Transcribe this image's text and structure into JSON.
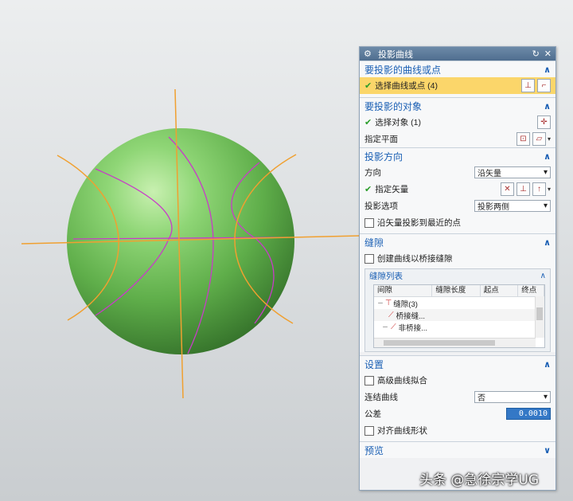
{
  "dialog": {
    "title": "投影曲线",
    "title_icon": "gear-icon",
    "reset_icon": "reset-icon",
    "close_icon": "close-icon"
  },
  "sections": {
    "curves": {
      "header": "要投影的曲线或点",
      "select_label": "选择曲线或点 (4)"
    },
    "target": {
      "header": "要投影的对象",
      "select_label": "选择对象 (1)",
      "plane_label": "指定平面"
    },
    "direction": {
      "header": "投影方向",
      "direction_label": "方向",
      "direction_value": "沿矢量",
      "vector_label": "指定矢量",
      "option_label": "投影选项",
      "option_value": "投影两侧",
      "nearest_label": "沿矢量投影到最近的点"
    },
    "gaps": {
      "header": "缝隙",
      "bridge_label": "创建曲线以桥接缝隙",
      "list_header": "缝隙列表",
      "columns": [
        "间隙",
        "缝隙长度",
        "起点",
        "终点"
      ],
      "rows": [
        "缝隙(3)",
        "桥接缝...",
        "非桥接..."
      ],
      "expand_root": "－",
      "expand_child": "－"
    },
    "settings": {
      "header": "设置",
      "hifi_label": "高级曲线拟合",
      "join_label": "连结曲线",
      "join_value": "否",
      "tolerance_label": "公差",
      "tolerance_value": "0.0010",
      "align_label": "对齐曲线形状"
    },
    "preview": {
      "header": "预览"
    }
  },
  "watermark": "头条 @急徐宗学UG",
  "colors": {
    "sphere": "#6cbf55",
    "construction_lines": "#f0a030",
    "projected_curves": "#c83cc8",
    "section_header": "#1a5fb4",
    "selection_highlight": "#fbd66a"
  }
}
